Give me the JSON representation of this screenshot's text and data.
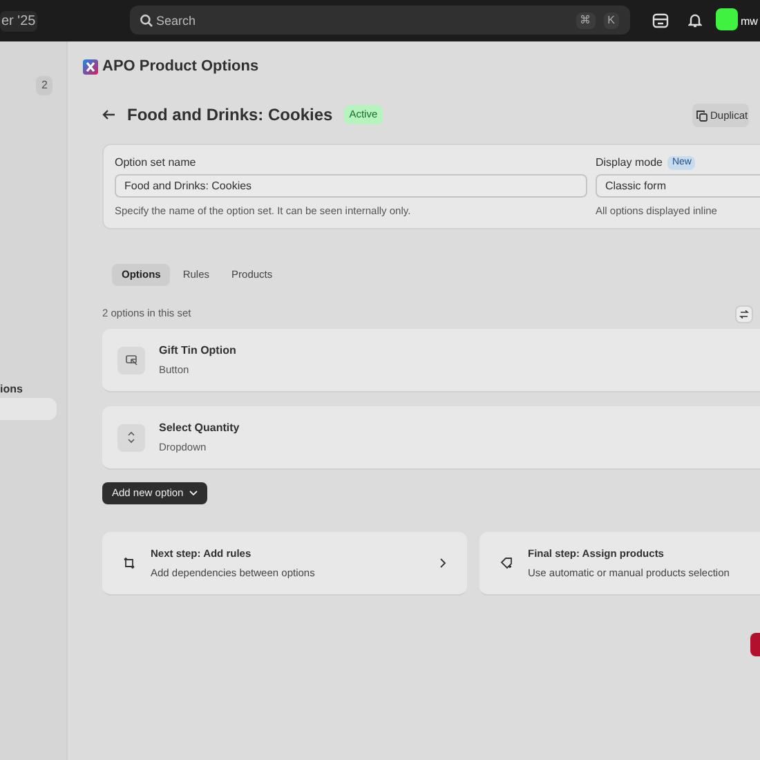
{
  "topbar": {
    "sidebar_label": "er '25",
    "search": {
      "placeholder": "Search",
      "shortcut": [
        "⌘",
        "K"
      ]
    },
    "user": "mw"
  },
  "sidebar": {
    "badge": "2",
    "items": [
      {
        "label": "ions",
        "selected": false
      },
      {
        "selected": true
      }
    ]
  },
  "app": {
    "title": "APO Product Options"
  },
  "page": {
    "title": "Food and Drinks: Cookies",
    "status": "Active",
    "duplicate": "Duplicat"
  },
  "form": {
    "name_label": "Option set name",
    "name_value": "Food and Drinks: Cookies",
    "name_help": "Specify the name of the option set. It can be seen internally only.",
    "mode_label": "Display mode",
    "mode_badge": "New",
    "mode_value": "Classic form",
    "mode_help": "All options displayed inline"
  },
  "tabs": [
    {
      "label": "Options",
      "selected": true
    },
    {
      "label": "Rules",
      "selected": false
    },
    {
      "label": "Products",
      "selected": false
    }
  ],
  "count": "2 options in this set",
  "options": [
    {
      "kind": "button",
      "name": "Gift Tin Option",
      "type": "Button"
    },
    {
      "kind": "dropdown",
      "name": "Select Quantity",
      "type": "Dropdown"
    }
  ],
  "add_button": "Add new option",
  "steps": [
    {
      "kind": "rules",
      "title": "Next step: Add rules",
      "text": "Add dependencies between options"
    },
    {
      "kind": "products",
      "title": "Final step: Assign products",
      "text": "Use automatic or manual products selection"
    }
  ]
}
